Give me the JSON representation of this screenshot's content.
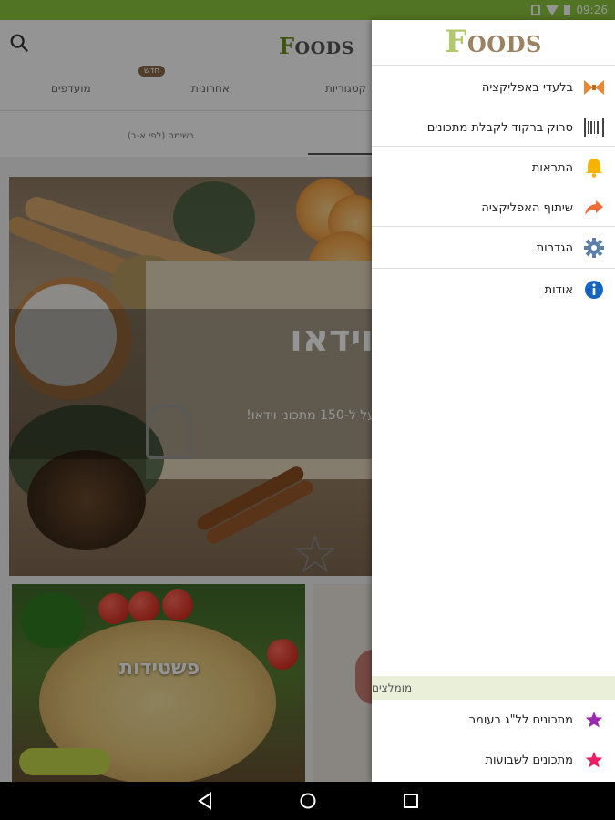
{
  "status_bar": {
    "time": "09:26"
  },
  "app": {
    "logo_first": "F",
    "logo_rest": "OODS",
    "tabs": [
      {
        "label": "קטגוריות"
      },
      {
        "label": "אחרונות"
      },
      {
        "label": "מועדפים"
      }
    ],
    "new_badge": "חדש",
    "subtab": "רשימה (לפי א-ב)",
    "hero_title": "וידאו",
    "hero_subtitle": "על ל-150 מתכוני וידאו!",
    "tile_label": "פשטידות"
  },
  "drawer": {
    "logo_first": "F",
    "logo_rest": "OODS",
    "items": [
      {
        "label": "בלעדי באפליקציה",
        "icon": "bowtie-icon",
        "color": "#e8893a"
      },
      {
        "label": "סרוק ברקוד לקבלת מתכונים",
        "icon": "barcode-icon",
        "color": "#555555"
      },
      {
        "label": "התראות",
        "icon": "bell-icon",
        "color": "#f5b400"
      },
      {
        "label": "שיתוף האפליקציה",
        "icon": "share-icon",
        "color": "#f26b3a"
      },
      {
        "label": "הגדרות",
        "icon": "gear-icon",
        "color": "#5b7fa8"
      },
      {
        "label": "אודות",
        "icon": "info-icon",
        "color": "#1565c0"
      }
    ],
    "section_title": "מומלצים",
    "recommended": [
      {
        "label": "מתכונים לל\"ג בעומר",
        "icon": "star-icon",
        "color": "#9c27b0"
      },
      {
        "label": "מתכונים לשבועות",
        "icon": "star-icon",
        "color": "#e91e63"
      }
    ]
  },
  "colors": {
    "accent_green": "#8cc63f",
    "drawer_section_bg": "#e9efd9"
  }
}
